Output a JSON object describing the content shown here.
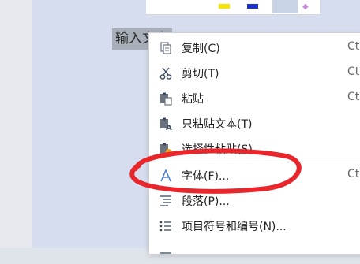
{
  "document": {
    "selected_text": "输入文字"
  },
  "context_menu": {
    "items": [
      {
        "label": "复制(C)",
        "shortcut": "Ct",
        "icon": "copy-icon"
      },
      {
        "label": "剪切(T)",
        "shortcut": "Ct",
        "icon": "scissors-icon"
      },
      {
        "label": "粘贴",
        "shortcut": "Ct",
        "icon": "paste-icon"
      },
      {
        "label": "只粘贴文本(T)",
        "shortcut": "",
        "icon": "paste-text-icon"
      },
      {
        "label": "选择性粘贴(S)...",
        "shortcut": "",
        "icon": "paste-special-icon"
      },
      {
        "label": "字体(F)...",
        "shortcut": "Ct",
        "icon": "font-icon"
      },
      {
        "label": "段落(P)...",
        "shortcut": "",
        "icon": "paragraph-icon"
      },
      {
        "label": "项目符号和编号(N)...",
        "shortcut": "",
        "icon": "bullet-list-icon"
      }
    ]
  },
  "annotation": {
    "color": "#e8262b"
  }
}
